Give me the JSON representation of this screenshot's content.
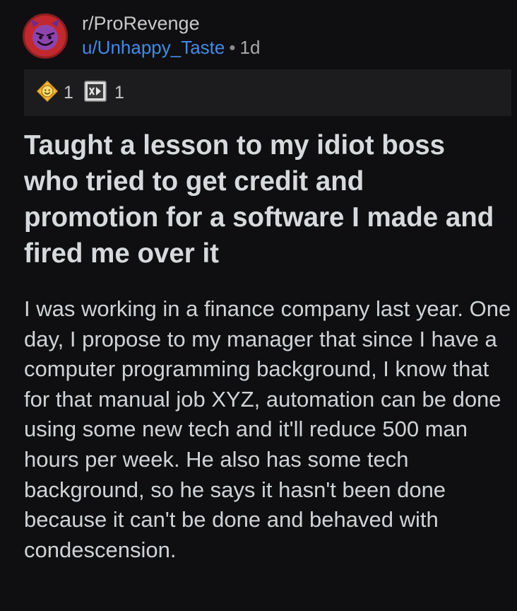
{
  "post": {
    "subreddit": "r/ProRevenge",
    "username": "u/Unhappy_Taste",
    "separator": "•",
    "age": "1d",
    "awards": [
      {
        "icon": "wholesome-award-icon",
        "count": "1"
      },
      {
        "icon": "gold-award-icon",
        "count": "1"
      }
    ],
    "title": "Taught a lesson to my idiot boss who tried to get credit and promotion for a software I made and fired me over it",
    "body": "I was working in a finance company last year. One day, I propose to my manager that since I have a computer programming background, I know that for that manual job XYZ, automation can be done using some new tech and it'll reduce 500 man hours per week. He also has some tech background, so he says it hasn't been done because it can't be done and behaved with condescension."
  },
  "colors": {
    "background": "#0f0f11",
    "username": "#3f8be8",
    "avatar": "#c1292e",
    "awards_bar": "#1c1c1e"
  }
}
